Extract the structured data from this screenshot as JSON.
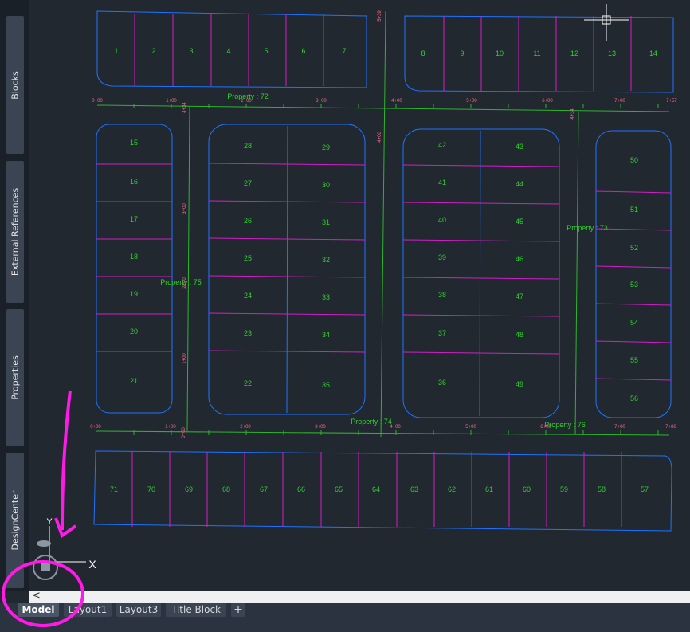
{
  "palette": {
    "tabs": [
      "Blocks",
      "External References",
      "Properties",
      "DesignCenter"
    ]
  },
  "layout_tabs": {
    "items": [
      "Model",
      "Layout1",
      "Layout3",
      "Title Block"
    ],
    "active": "Model",
    "add_symbol": "+"
  },
  "cmdline": {
    "scroll_symbol": "<"
  },
  "drawing": {
    "top_lots_left": [
      "1",
      "2",
      "3",
      "4",
      "5",
      "6",
      "7"
    ],
    "top_lots_right": [
      "8",
      "9",
      "10",
      "11",
      "12",
      "13",
      "14"
    ],
    "left_column": [
      "15",
      "16",
      "17",
      "18",
      "19",
      "20",
      "21"
    ],
    "mid_left_a": [
      "28",
      "27",
      "26",
      "25",
      "24",
      "23",
      "22"
    ],
    "mid_left_b": [
      "29",
      "30",
      "31",
      "32",
      "33",
      "34",
      "35"
    ],
    "mid_right_a": [
      "42",
      "41",
      "40",
      "39",
      "38",
      "37",
      "36"
    ],
    "mid_right_b": [
      "43",
      "44",
      "45",
      "46",
      "47",
      "48",
      "49"
    ],
    "right_column": [
      "50",
      "51",
      "52",
      "53",
      "54",
      "55",
      "56"
    ],
    "bottom_lots": [
      "71",
      "70",
      "69",
      "68",
      "67",
      "66",
      "65",
      "64",
      "63",
      "62",
      "61",
      "60",
      "59",
      "58",
      "57"
    ],
    "properties": [
      "Property : 72",
      "Property : 75",
      "Property : 74",
      "Property : 76",
      "Property : 73"
    ],
    "stations_top": [
      "0+00",
      "1+00",
      "2+00",
      "3+00",
      "4+00",
      "5+00",
      "6+00",
      "7+00",
      "7+57"
    ],
    "stations_bottom": [
      "0+00",
      "1+00",
      "2+00",
      "3+00",
      "4+00",
      "5+00",
      "6+00",
      "7+00",
      "7+86"
    ],
    "stations_vertical": [
      "4+34",
      "3+00",
      "2+00",
      "1+00",
      "0+00",
      "5+39",
      "4+00",
      "4+34"
    ],
    "ucs": {
      "y_label": "Y",
      "x_label": "X"
    },
    "colors": {
      "parcel": "#1e74ff",
      "lot_line": "#d21ec8",
      "alignment": "#2db52d",
      "label": "#31d02f",
      "station": "#ff6b8a",
      "highlight": "#ff1ae8"
    }
  }
}
